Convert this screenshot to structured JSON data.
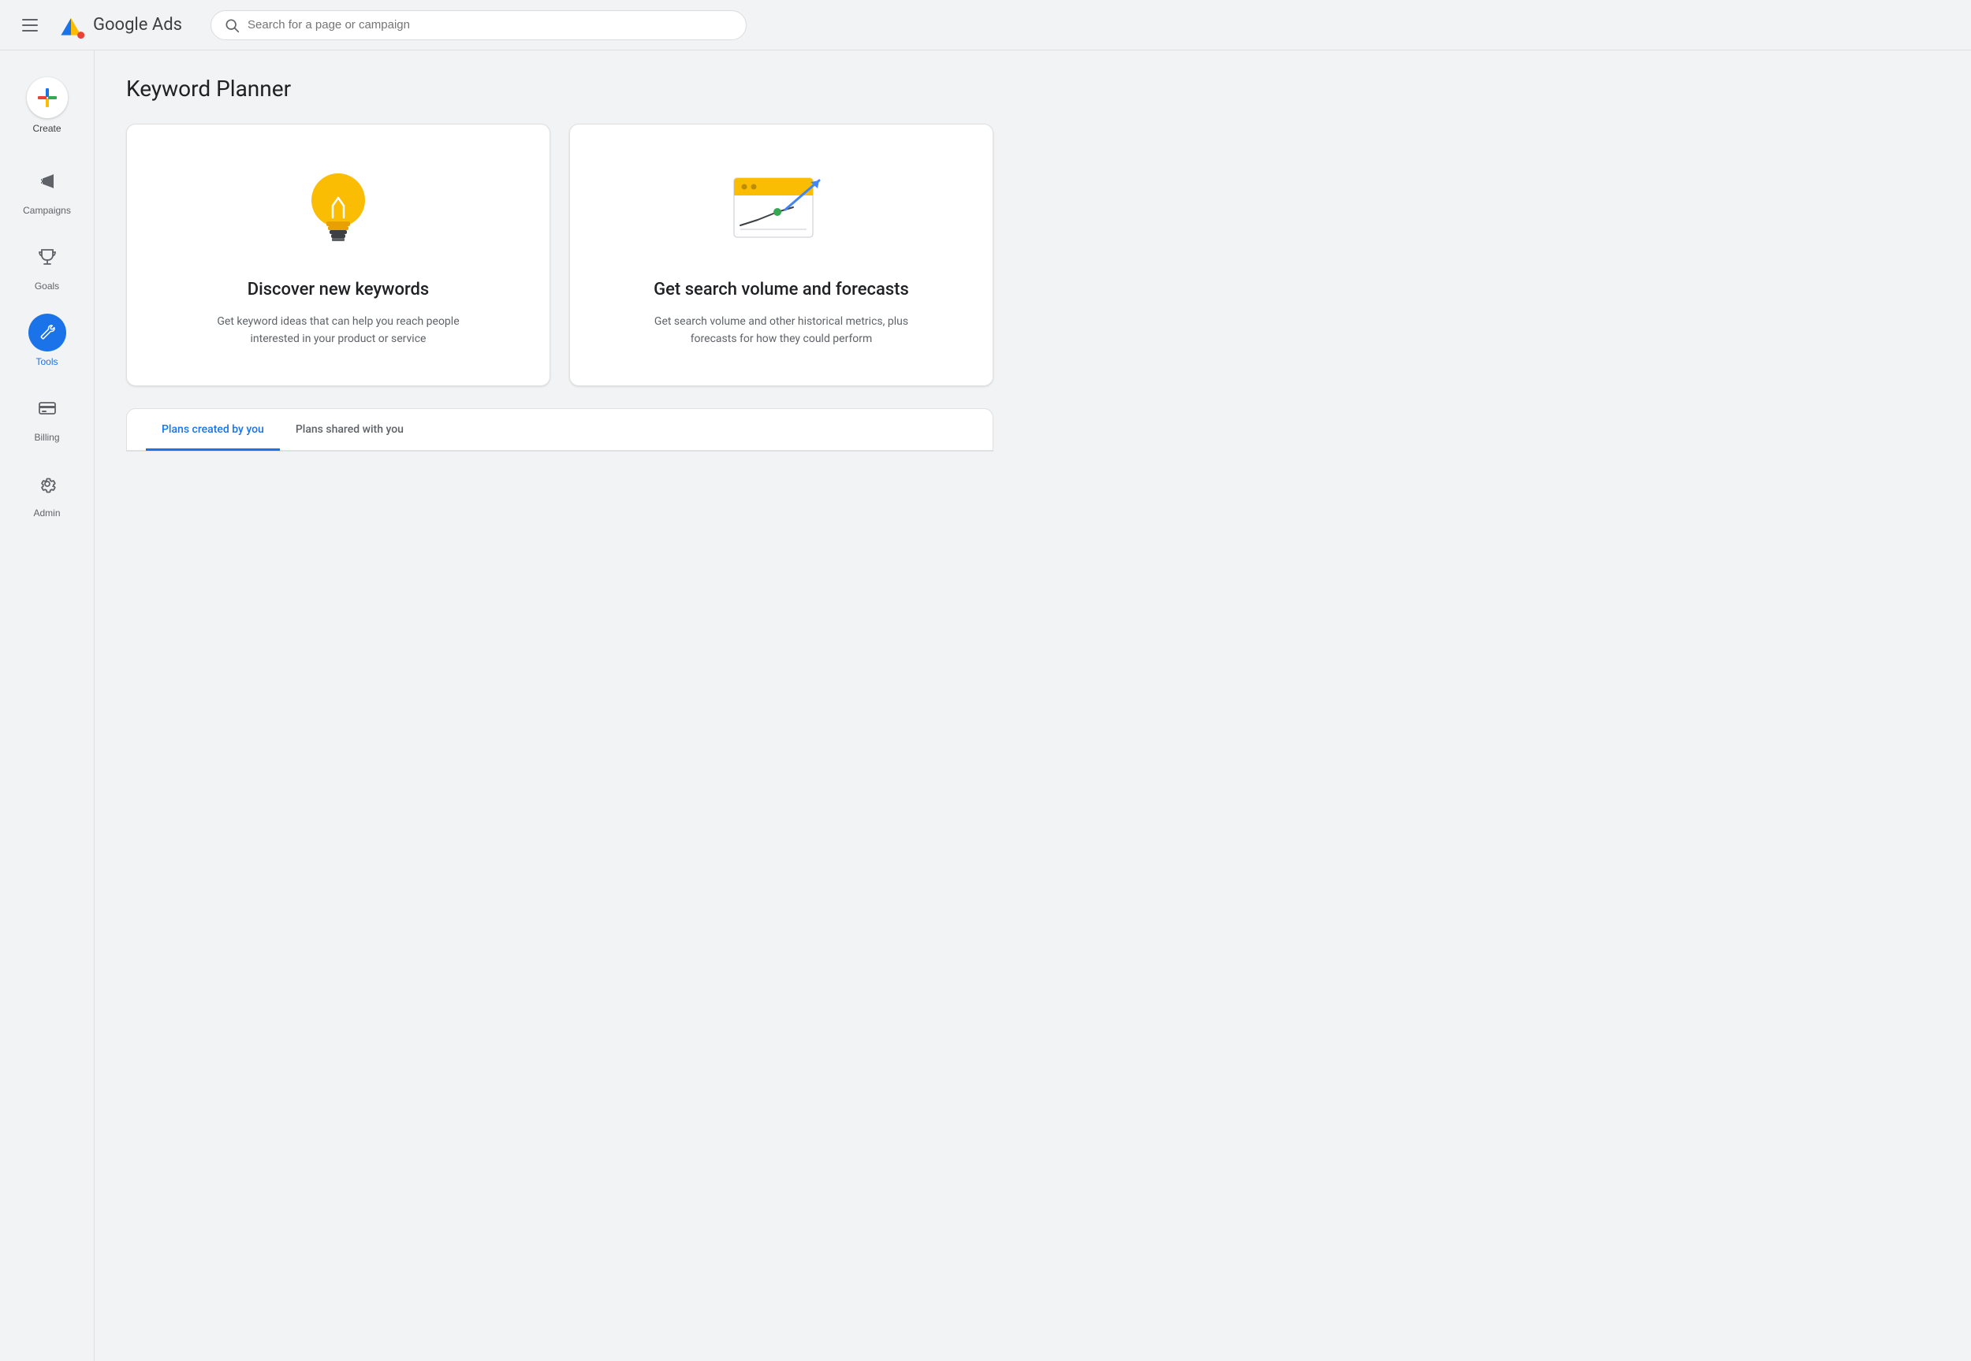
{
  "header": {
    "menu_label": "Menu",
    "logo_text": "Google Ads",
    "search_placeholder": "Search for a page or campaign"
  },
  "sidebar": {
    "create_label": "Create",
    "items": [
      {
        "id": "campaigns",
        "label": "Campaigns",
        "icon": "campaigns-icon"
      },
      {
        "id": "goals",
        "label": "Goals",
        "icon": "goals-icon"
      },
      {
        "id": "tools",
        "label": "Tools",
        "icon": "tools-icon",
        "active": true
      },
      {
        "id": "billing",
        "label": "Billing",
        "icon": "billing-icon"
      },
      {
        "id": "admin",
        "label": "Admin",
        "icon": "admin-icon"
      }
    ]
  },
  "main": {
    "page_title": "Keyword Planner",
    "cards": [
      {
        "id": "discover",
        "title": "Discover new keywords",
        "description": "Get keyword ideas that can help you reach people interested in your product or service",
        "icon": "lightbulb-icon"
      },
      {
        "id": "forecasts",
        "title": "Get search volume and forecasts",
        "description": "Get search volume and other historical metrics, plus forecasts for how they could perform",
        "icon": "chart-icon"
      }
    ],
    "tabs": [
      {
        "id": "created-by-you",
        "label": "Plans created by you",
        "active": true
      },
      {
        "id": "shared-with-you",
        "label": "Plans shared with you",
        "active": false
      }
    ]
  },
  "colors": {
    "google_blue": "#1a73e8",
    "google_red": "#ea4335",
    "google_yellow": "#fbbc04",
    "google_green": "#34a853",
    "active_nav": "#1a73e8",
    "text_primary": "#202124",
    "text_secondary": "#5f6368"
  }
}
